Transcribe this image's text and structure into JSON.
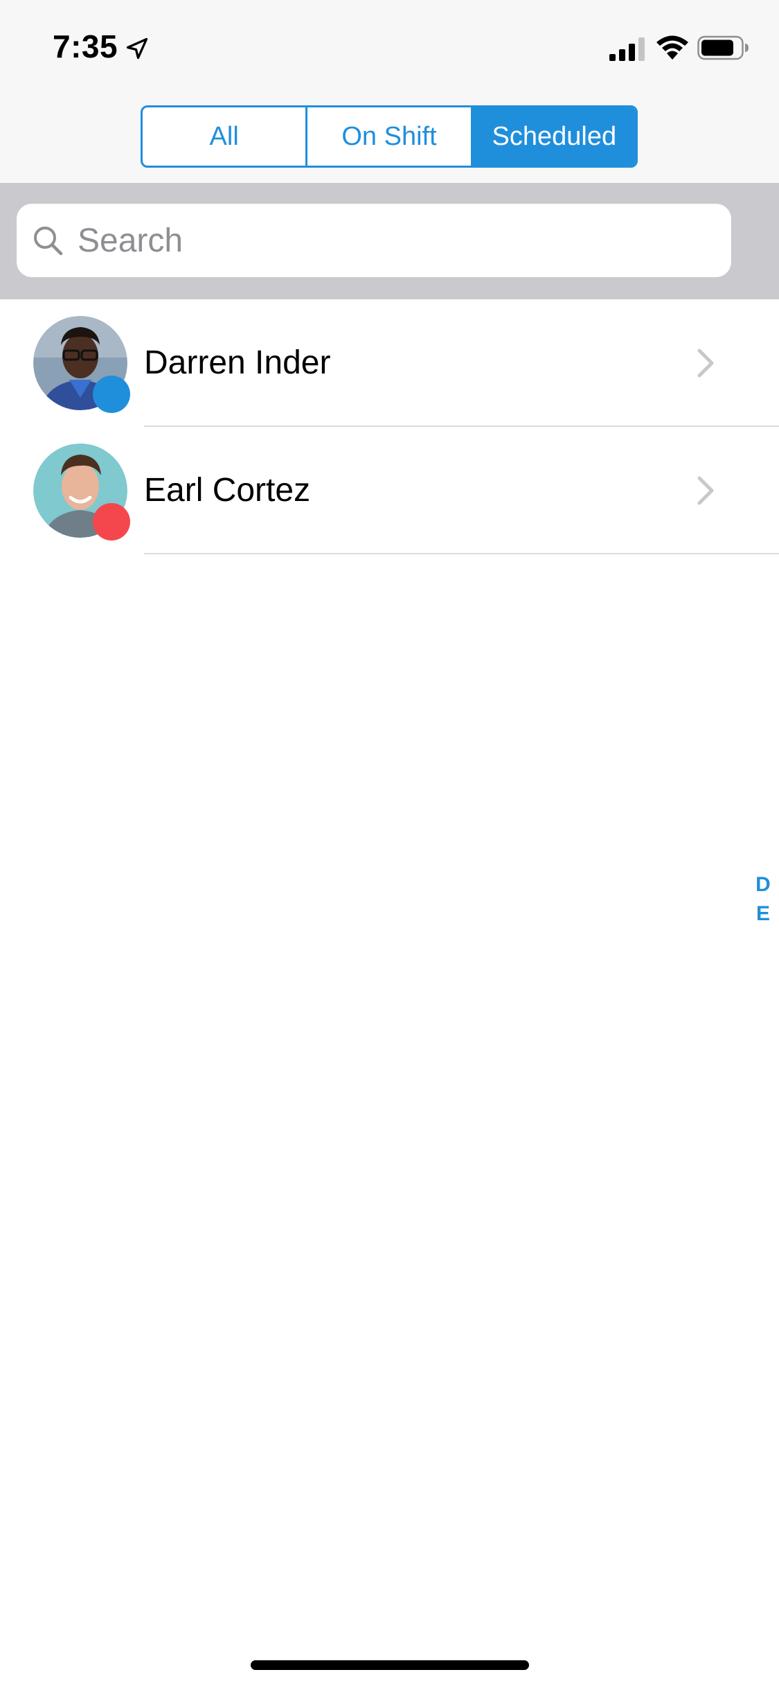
{
  "status_bar": {
    "time": "7:35",
    "icons": [
      "location-arrow-icon",
      "cellular-signal-icon",
      "wifi-icon",
      "battery-icon"
    ]
  },
  "segmented_control": {
    "segments": [
      {
        "label": "All",
        "active": false
      },
      {
        "label": "On Shift",
        "active": false
      },
      {
        "label": "Scheduled",
        "active": true
      }
    ]
  },
  "search": {
    "placeholder": "Search",
    "value": ""
  },
  "contacts": [
    {
      "name": "Darren Inder",
      "status_color": "#1f8fdc",
      "avatar": "avatar-photo"
    },
    {
      "name": "Earl Cortez",
      "status_color": "#f4474d",
      "avatar": "avatar-photo"
    }
  ],
  "section_index": [
    "D",
    "E"
  ],
  "colors": {
    "accent": "#1f8fdc",
    "status_blue": "#1f8fdc",
    "status_red": "#f4474d",
    "search_bar_bg": "#c9c9ce",
    "header_bg": "#f7f7f7"
  }
}
